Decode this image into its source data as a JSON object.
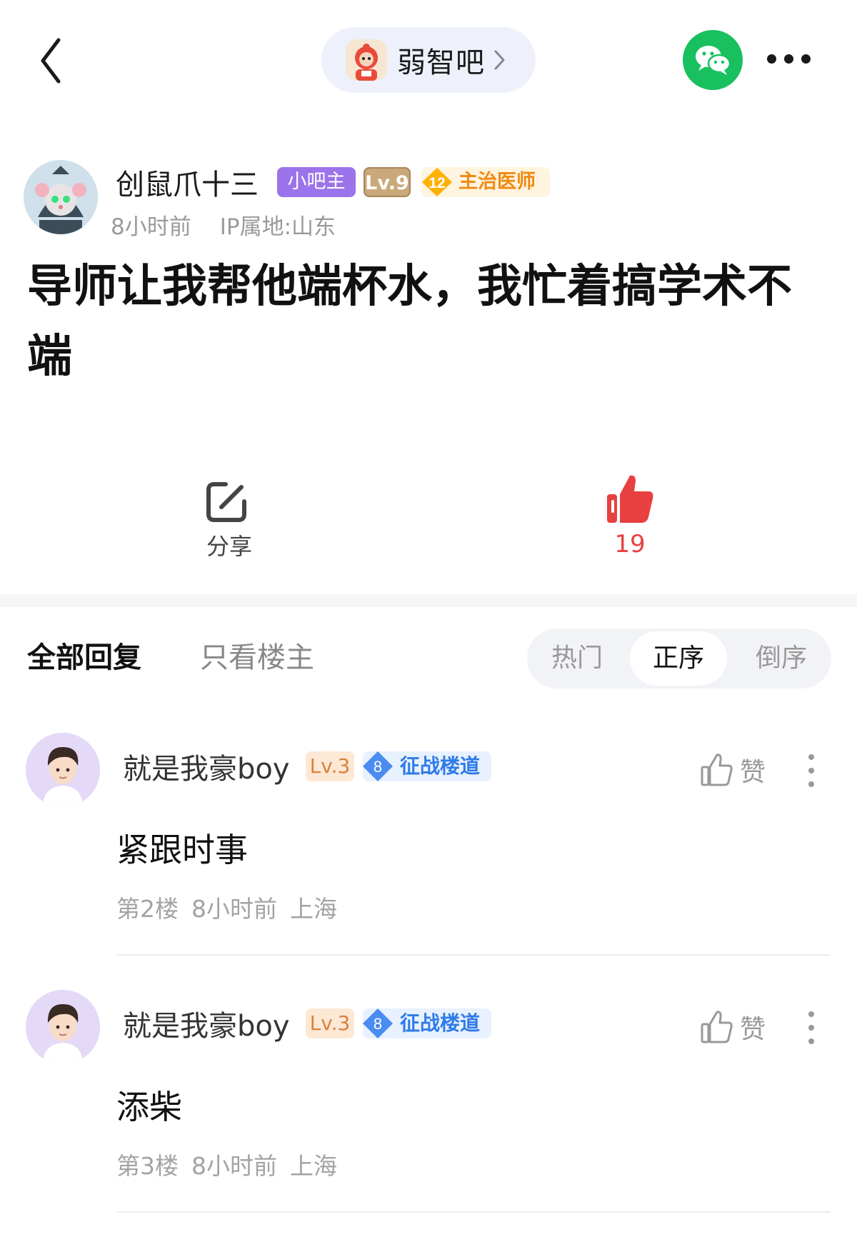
{
  "header": {
    "forum_name": "弱智吧"
  },
  "post": {
    "author": {
      "name": "创鼠爪十三",
      "role_badge": "小吧主",
      "level_badge": "Lv.9",
      "honor_level": "12",
      "honor_title": "主治医师",
      "time": "8小时前",
      "ip": "IP属地:山东"
    },
    "title": "导师让我帮他端杯水，我忙着搞学术不端",
    "share_label": "分享",
    "like_count": "19"
  },
  "tabs": {
    "all": "全部回复",
    "owner_only": "只看楼主",
    "sort": [
      "热门",
      "正序",
      "倒序"
    ],
    "sort_selected": "正序"
  },
  "replies": [
    {
      "name": "就是我豪boy",
      "level": "Lv.3",
      "tag_level": "8",
      "tag_title": "征战楼道",
      "like_label": "赞",
      "content": "紧跟时事",
      "floor": "第2楼",
      "time": "8小时前",
      "location": "上海"
    },
    {
      "name": "就是我豪boy",
      "level": "Lv.3",
      "tag_level": "8",
      "tag_title": "征战楼道",
      "like_label": "赞",
      "content": "添柴",
      "floor": "第3楼",
      "time": "8小时前",
      "location": "上海"
    }
  ],
  "colors": {
    "accent_like": "#e84040",
    "wechat_green": "#18c060",
    "admin_badge": "#9b73ea",
    "honor_orange": "#f08a12",
    "tag_blue": "#2f7be8"
  },
  "icons": [
    "back-arrow-icon",
    "chevron-right-icon",
    "wechat-icon",
    "more-dots-icon",
    "share-icon",
    "thumb-up-filled-icon",
    "thumb-up-outline-icon",
    "more-vertical-icon"
  ]
}
